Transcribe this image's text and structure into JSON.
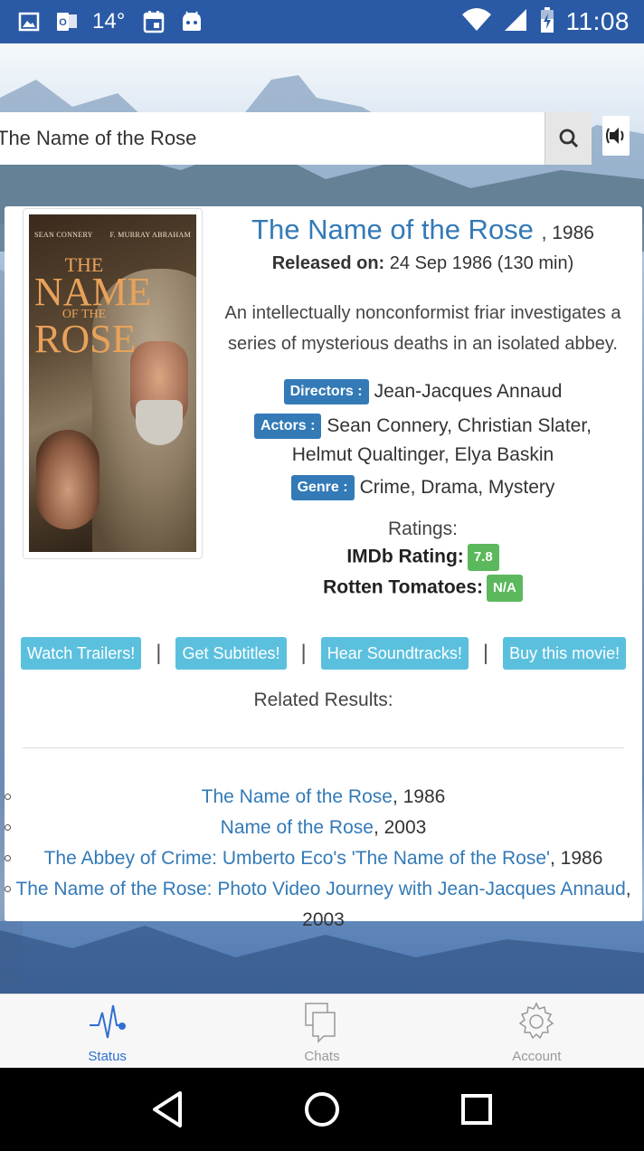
{
  "status_bar": {
    "temperature": "14°",
    "time": "11:08"
  },
  "search": {
    "value": "The Name of the Rose"
  },
  "movie": {
    "title": "The Name of the Rose",
    "year_suffix": ", 1986",
    "released_label": "Released on:",
    "released_value": "24 Sep 1986 (130 min)",
    "plot": "An intellectually nonconformist friar investigates a series of mysterious deaths in an isolated abbey.",
    "directors_label": "Directors :",
    "directors": "Jean-Jacques Annaud",
    "actors_label": "Actors :",
    "actors": "Sean Connery, Christian Slater, Helmut Qualtinger, Elya Baskin",
    "genre_label": "Genre :",
    "genre": "Crime, Drama, Mystery",
    "ratings_label": "Ratings:",
    "imdb_label": "IMDb Rating:",
    "imdb_value": "7.8",
    "rt_label": "Rotten Tomatoes:",
    "rt_value": "N/A"
  },
  "poster": {
    "credit_left": "SEAN CONNERY",
    "credit_right": "F. MURRAY ABRAHAM",
    "title_line1": "THE",
    "title_line2": "NAME",
    "title_line3": "OF THE",
    "title_line4": "ROSE"
  },
  "actions": {
    "trailers": "Watch Trailers!",
    "subtitles": "Get Subtitles!",
    "soundtracks": "Hear Soundtracks!",
    "buy": "Buy this movie!",
    "separator": "|"
  },
  "related": {
    "heading": "Related Results:",
    "items": [
      {
        "title": "The Name of the Rose",
        "year": ", 1986"
      },
      {
        "title": "Name of the Rose",
        "year": ", 2003"
      },
      {
        "title": "The Abbey of Crime: Umberto Eco's 'The Name of the Rose'",
        "year": ", 1986"
      },
      {
        "title": "The Name of the Rose: Photo Video Journey with Jean-Jacques Annaud",
        "year": ", 2003"
      }
    ]
  },
  "tabs": {
    "status": "Status",
    "chats": "Chats",
    "account": "Account"
  },
  "colors": {
    "status_bar": "#2a5aa6",
    "link": "#337ab7",
    "badge_blue": "#337ab7",
    "badge_green": "#5cb85c",
    "action_button": "#5bc0de",
    "active_tab": "#2f6fd0"
  }
}
